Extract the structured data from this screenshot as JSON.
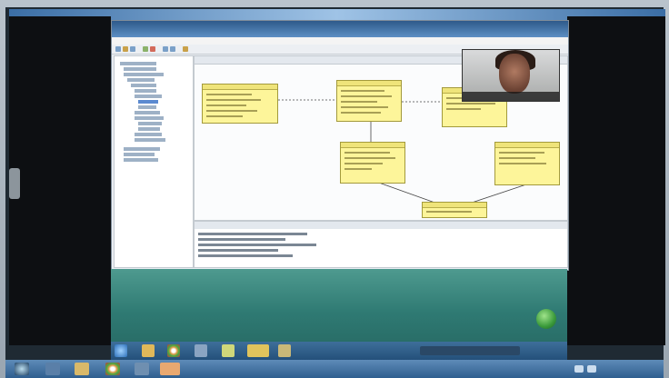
{
  "remote_window": {
    "title": "",
    "menu": [
      "",
      "",
      "",
      "",
      "",
      "",
      ""
    ],
    "status_notice": ""
  },
  "webcam": {
    "caption": ""
  },
  "local_taskbar": {
    "clock_time": "",
    "clock_date": ""
  },
  "colors": {
    "uml_fill": "#fdf59a",
    "title_bar": "#2e5a8a",
    "wallpaper": "#2f7a73",
    "taskbar": "#2f5e8f"
  },
  "icons": [
    "start-orb-icon",
    "folder-icon",
    "chrome-icon",
    "media-icon",
    "ide-icon",
    "tray-icon",
    "network-icon",
    "volume-icon"
  ]
}
